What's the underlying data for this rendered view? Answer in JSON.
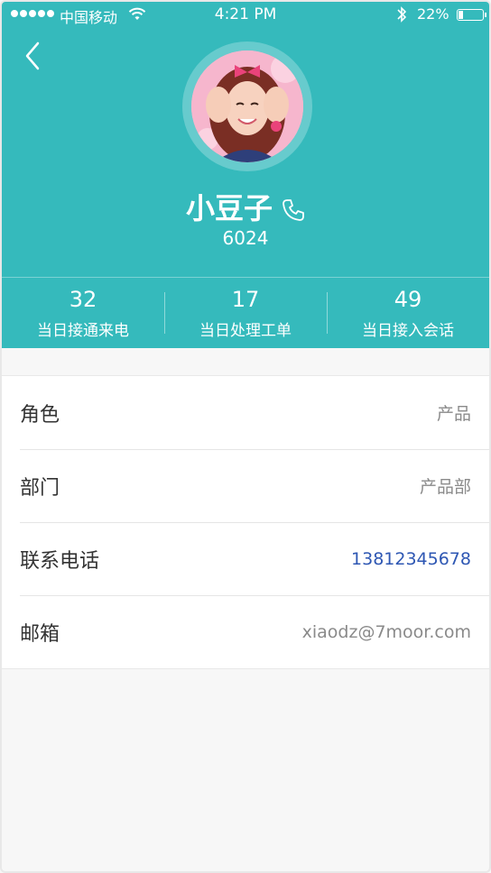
{
  "status_bar": {
    "carrier": "中国移动",
    "time": "4:21 PM",
    "battery": "22%"
  },
  "profile": {
    "name": "小豆子",
    "extension": "6024"
  },
  "stats": [
    {
      "value": "32",
      "label": "当日接通来电"
    },
    {
      "value": "17",
      "label": "当日处理工单"
    },
    {
      "value": "49",
      "label": "当日接入会话"
    }
  ],
  "info": [
    {
      "label": "角色",
      "value": "产品"
    },
    {
      "label": "部门",
      "value": "产品部"
    },
    {
      "label": "联系电话",
      "value": "13812345678"
    },
    {
      "label": "邮箱",
      "value": "xiaodz@7moor.com"
    }
  ],
  "colors": {
    "header": "#35babc",
    "link": "#2e57b3"
  }
}
